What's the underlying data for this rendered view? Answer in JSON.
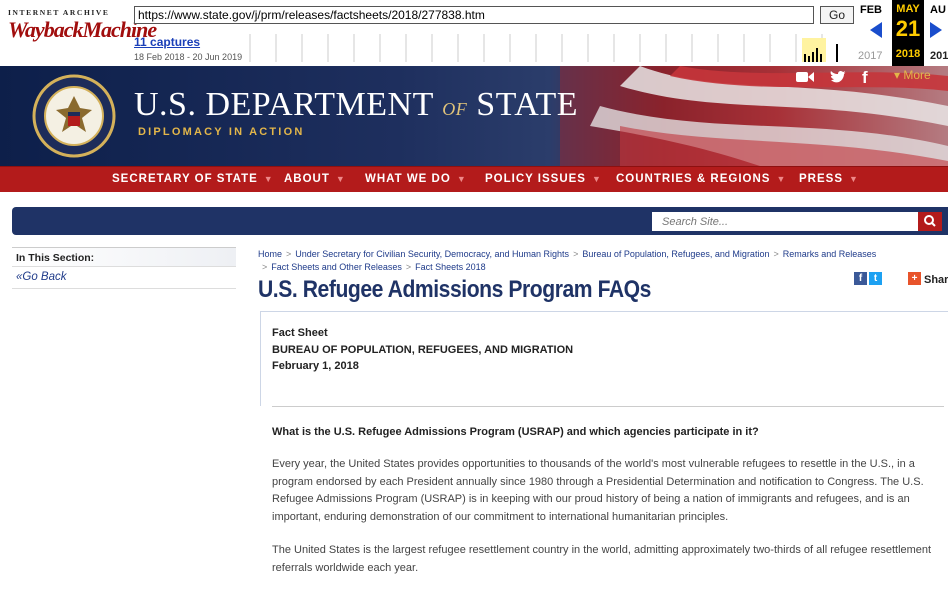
{
  "wayback": {
    "logo_top": "INTERNET ARCHIVE",
    "logo_main": "WaybackMachine",
    "url": "https://www.state.gov/j/prm/releases/factsheets/2018/277838.htm",
    "go_label": "Go",
    "captures_label": "11 captures",
    "date_range": "18 Feb 2018 - 20 Jun 2019",
    "prev_month": "FEB",
    "current_month": "MAY",
    "next_month": "AU",
    "current_day": "21",
    "prev_year": "2017",
    "current_year": "2018",
    "next_year": "201"
  },
  "header": {
    "title_main": "U.S. DEPARTMENT",
    "title_of": "OF",
    "title_end": "STATE",
    "tagline": "DIPLOMACY IN ACTION",
    "seal_text": "DEPARTMENT OF STATE • UNITED STATES OF AMERICA",
    "more_label": "▾ More",
    "social_icons": [
      "video-icon",
      "twitter-icon",
      "facebook-icon"
    ]
  },
  "nav": {
    "items": [
      "SECRETARY OF STATE",
      "ABOUT",
      "WHAT WE DO",
      "POLICY ISSUES",
      "COUNTRIES & REGIONS",
      "PRESS"
    ],
    "caret": "▼"
  },
  "search": {
    "placeholder": "Search Site..."
  },
  "sidebar": {
    "section_label": "In This Section:",
    "back_label": "«Go Back"
  },
  "breadcrumb": {
    "items": [
      "Home",
      "Under Secretary for Civilian Security, Democracy, and Human Rights",
      "Bureau of Population, Refugees, and Migration",
      "Remarks and Releases",
      "Fact Sheets and Other Releases",
      "Fact Sheets 2018"
    ],
    "separator": ">"
  },
  "article": {
    "title": "U.S. Refugee Admissions Program FAQs",
    "share_label": "Share",
    "type": "Fact Sheet",
    "bureau": "BUREAU OF POPULATION, REFUGEES, AND MIGRATION",
    "date": "February 1, 2018",
    "question_1": "What is the U.S. Refugee Admissions Program (USRAP) and which agencies participate in it?",
    "paragraph_1": "Every year, the United States provides opportunities to thousands of the world's most vulnerable refugees to resettle in the U.S., in a program endorsed by each President annually since 1980 through a Presidential Determination and notification to Congress. The U.S. Refugee Admissions Program (USRAP) is in keeping with our proud history of being a nation of immigrants and refugees, and is an important, enduring demonstration of our commitment to international humanitarian principles.",
    "paragraph_2": "The United States is the largest refugee resettlement country in the world, admitting approximately two-thirds of all refugee resettlement referrals worldwide each year."
  },
  "colors": {
    "nav_red": "#b31b1b",
    "navy": "#1f3366",
    "gold": "#e3b64a",
    "link_blue": "#1f3b8a"
  }
}
